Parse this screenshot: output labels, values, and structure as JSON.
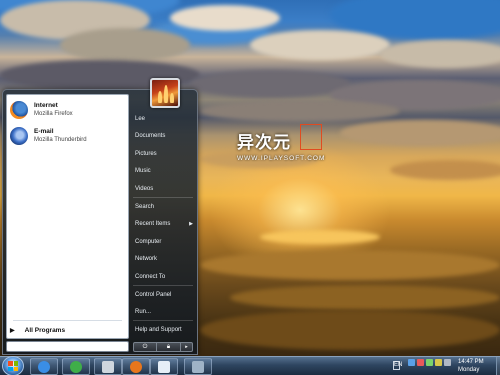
{
  "watermark": {
    "title": "异次元",
    "subtitle": "WWW.IPLAYSOFT.COM"
  },
  "start_menu": {
    "pinned": [
      {
        "name": "Internet",
        "desc": "Mozilla Firefox",
        "icon": "firefox-icon"
      },
      {
        "name": "E-mail",
        "desc": "Mozilla Thunderbird",
        "icon": "thunderbird-icon"
      }
    ],
    "all_programs": "All Programs",
    "search_placeholder": "",
    "user_picture": "user-picture-flames",
    "right_items": [
      {
        "label": "Lee"
      },
      {
        "label": "Documents"
      },
      {
        "label": "Pictures"
      },
      {
        "label": "Music"
      },
      {
        "label": "Videos"
      },
      {
        "label": "Search"
      },
      {
        "label": "Recent Items",
        "has_submenu": true
      },
      {
        "label": "Computer"
      },
      {
        "label": "Network"
      },
      {
        "label": "Connect To"
      },
      {
        "label": "Control Panel"
      },
      {
        "label": "Run..."
      },
      {
        "label": "Help and Support"
      }
    ],
    "power_icon": "power-icon",
    "lock_icon": "lock-icon",
    "power_arrow": "▸"
  },
  "taskbar": {
    "buttons": [
      {
        "name": "internet-explorer",
        "color": "#3a8ee6"
      },
      {
        "name": "windows-live-messenger",
        "color": "#3fae49"
      },
      {
        "name": "mail",
        "color": "#cfd6de"
      },
      {
        "name": "firefox",
        "color": "#e8761c"
      },
      {
        "name": "notepad",
        "color": "#e6eef7"
      },
      {
        "name": "recycle-bin",
        "color": "#9fb3c7"
      }
    ],
    "language": "EN",
    "tray_icons": [
      "#5aa0e8",
      "#e85a5a",
      "#7cd36a",
      "#d8c64a",
      "#b0b8c4",
      "#5ad0d8"
    ],
    "clock": {
      "time": "14:47 PM",
      "day": "Monday"
    }
  }
}
